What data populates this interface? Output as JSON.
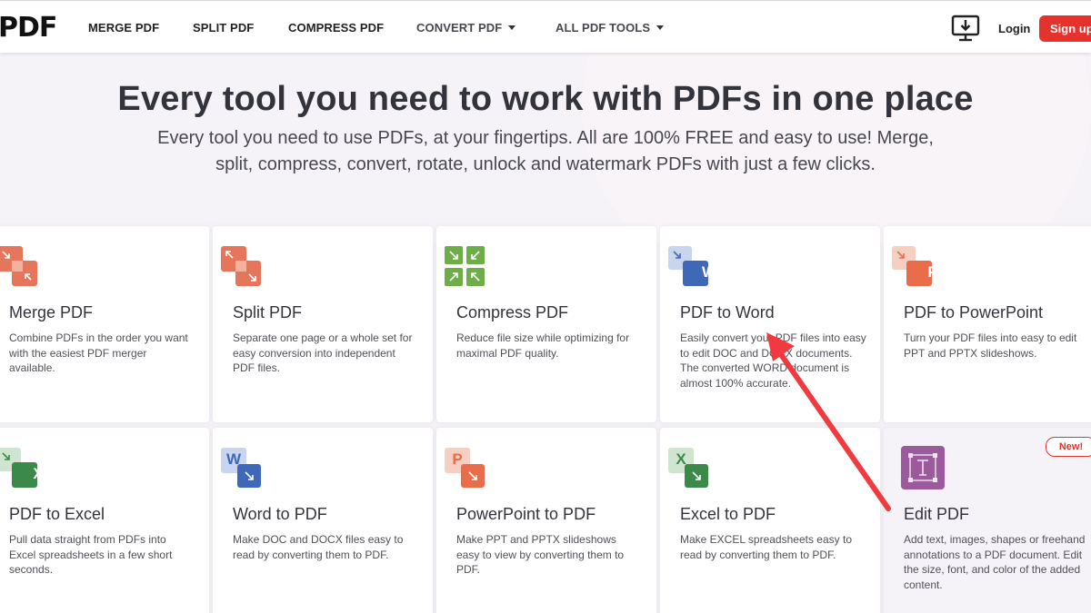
{
  "nav": {
    "logo": "PDF",
    "items": [
      "MERGE PDF",
      "SPLIT PDF",
      "COMPRESS PDF",
      "CONVERT PDF",
      "ALL PDF TOOLS"
    ],
    "login": "Login",
    "signup": "Sign up"
  },
  "hero": {
    "title": "Every tool you need to work with PDFs in one place",
    "subtitle_line1": "Every tool you need to use PDFs, at your fingertips. All are 100% FREE and easy to use! Merge,",
    "subtitle_line2": "split, compress, convert, rotate, unlock and watermark PDFs with just a few clicks."
  },
  "tools": [
    {
      "title": "Merge PDF",
      "desc": "Combine PDFs in the order you want with the easiest PDF merger available.",
      "icon": "merge-icon"
    },
    {
      "title": "Split PDF",
      "desc": "Separate one page or a whole set for easy conversion into independent PDF files.",
      "icon": "split-icon"
    },
    {
      "title": "Compress PDF",
      "desc": "Reduce file size while optimizing for maximal PDF quality.",
      "icon": "compress-icon"
    },
    {
      "title": "PDF to Word",
      "desc": "Easily convert your PDF files into easy to edit DOC and DOCX documents. The converted WORD document is almost 100% accurate.",
      "icon": "word-icon"
    },
    {
      "title": "PDF to PowerPoint",
      "desc": "Turn your PDF files into easy to edit PPT and PPTX slideshows.",
      "icon": "powerpoint-icon"
    },
    {
      "title": "PDF to Excel",
      "desc": "Pull data straight from PDFs into Excel spreadsheets in a few short seconds.",
      "icon": "excel-icon"
    },
    {
      "title": "Word to PDF",
      "desc": "Make DOC and DOCX files easy to read by converting them to PDF.",
      "icon": "word-icon"
    },
    {
      "title": "PowerPoint to PDF",
      "desc": "Make PPT and PPTX slideshows easy to view by converting them to PDF.",
      "icon": "powerpoint-icon"
    },
    {
      "title": "Excel to PDF",
      "desc": "Make EXCEL spreadsheets easy to read by converting them to PDF.",
      "icon": "excel-icon"
    },
    {
      "title": "Edit PDF",
      "desc": "Add text, images, shapes or freehand annotations to a PDF document. Edit the size, font, and color of the added content.",
      "icon": "edit-icon",
      "badge": "New!"
    }
  ],
  "icon_letters": {
    "word": "W",
    "powerpoint": "P",
    "excel": "X"
  },
  "colors": {
    "brand": "#e5322d",
    "merge": "#e5765b",
    "compress": "#6fad49",
    "word": "#3f68b8",
    "powerpoint": "#e96d4a",
    "excel": "#3b8a4a",
    "edit": "#9b5a9c",
    "annotation": "#f03a3f"
  }
}
